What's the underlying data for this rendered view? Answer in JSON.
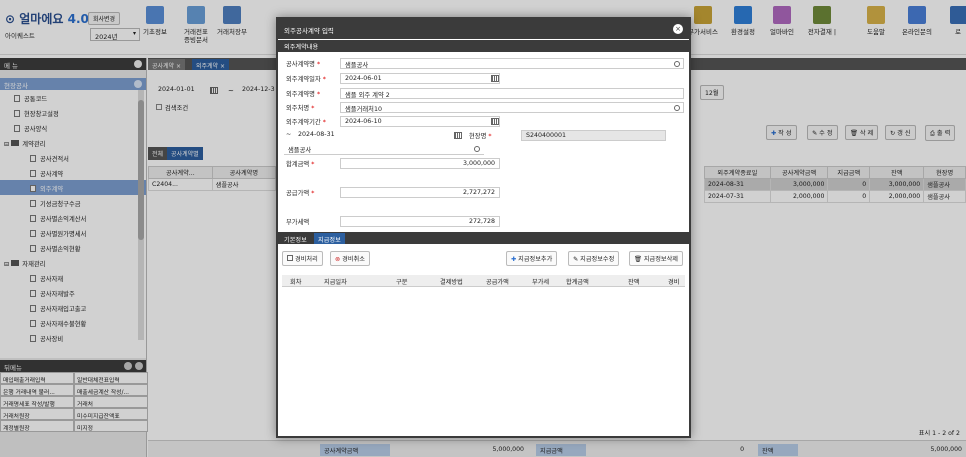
{
  "app": {
    "logo_a": "얼마에요",
    "logo_v": "4.0",
    "company_change": "회사변경",
    "company": "아이퀘스트",
    "year": "2024년"
  },
  "toolbar": [
    {
      "label": "기초정보",
      "color": "#5a8fd8"
    },
    {
      "label": "거래전표\n증빙문서",
      "color": "#6a9fd8"
    },
    {
      "label": "거래처장부",
      "color": "#4f7fc0"
    },
    {
      "label": "부가서비스",
      "color": "#c9a437"
    },
    {
      "label": "환경설정",
      "color": "#2f7fd8"
    },
    {
      "label": "얼마바인",
      "color": "#b06ac0"
    },
    {
      "label": "전자결재 |",
      "color": "#6f8a3a"
    },
    {
      "label": "도움말",
      "color": "#d8b24a"
    },
    {
      "label": "온라인문의",
      "color": "#4a7fd8"
    },
    {
      "label": "로",
      "color": "#3a6fb8"
    }
  ],
  "sidebar": {
    "menu_label": "메 뉴",
    "section": "현장공사",
    "items": [
      {
        "label": "공통코드",
        "level": 1,
        "type": "doc"
      },
      {
        "label": "현장창고설정",
        "level": 1,
        "type": "doc"
      },
      {
        "label": "공사양식",
        "level": 1,
        "type": "doc"
      },
      {
        "label": "계약관리",
        "level": 0,
        "type": "folder"
      },
      {
        "label": "공사견적서",
        "level": 2,
        "type": "doc"
      },
      {
        "label": "공사계약",
        "level": 2,
        "type": "doc"
      },
      {
        "label": "외주계약",
        "level": 2,
        "type": "doc",
        "selected": true
      },
      {
        "label": "기성금청구수금",
        "level": 2,
        "type": "doc"
      },
      {
        "label": "공사별손익계산서",
        "level": 2,
        "type": "doc"
      },
      {
        "label": "공사별원가명세서",
        "level": 2,
        "type": "doc"
      },
      {
        "label": "공사별손익현황",
        "level": 2,
        "type": "doc"
      },
      {
        "label": "자재관리",
        "level": 0,
        "type": "folder"
      },
      {
        "label": "공사자재",
        "level": 2,
        "type": "doc"
      },
      {
        "label": "공사자재발주",
        "level": 2,
        "type": "doc"
      },
      {
        "label": "공사자재입고출고",
        "level": 2,
        "type": "doc"
      },
      {
        "label": "공사자재수불현황",
        "level": 2,
        "type": "doc"
      },
      {
        "label": "공사장비",
        "level": 2,
        "type": "doc"
      }
    ],
    "fav_label": "뒤메뉴",
    "favorites": [
      "매입매출거래입력",
      "일반대체전표입력",
      "은행 거래내역 불러...",
      "매출세금계산 작성/...",
      "거래명세표 작성/발행",
      "거래처",
      "거래처원장",
      "미수미지급잔액표",
      "계정별원장",
      "미지정"
    ]
  },
  "main": {
    "tabs": [
      "공사계약",
      "외주계약"
    ],
    "date_from": "2024-01-01",
    "date_to": "2024-12-3",
    "search_cond": "검색조건",
    "month_btn": "12월",
    "grid_tabs": [
      "전체",
      "공사계약별"
    ],
    "actions": [
      "작 성",
      "수 정",
      "삭 제",
      "갱 신",
      "출 력"
    ],
    "left_headers": [
      "공사계약...",
      "공사계약명"
    ],
    "left_rows": [
      [
        "C2404...",
        "샘플공사"
      ]
    ],
    "right_headers": [
      "외주계약종료일",
      "공사계약금액",
      "지급금액",
      "잔액",
      "현장명"
    ],
    "right_rows": [
      [
        "2024-08-31",
        "3,000,000",
        "0",
        "3,000,000",
        "샘플공사"
      ],
      [
        "2024-07-31",
        "2,000,000",
        "0",
        "2,000,000",
        "샘플공사"
      ]
    ],
    "paging": "표시 1 - 2 of 2"
  },
  "footer": {
    "label1": "공사계약금액",
    "val1": "5,000,000",
    "label2": "지급금액",
    "val2": "0",
    "label3": "잔액",
    "val3": "5,000,000"
  },
  "modal": {
    "title": "외주공사계약 입력",
    "section": "외주계약내용",
    "fields": {
      "project_label": "공사계약명",
      "project": "샘플공사",
      "date_label": "외주계약일자",
      "date": "2024-06-01",
      "name_label": "외주계약명",
      "name": "샘플 외주 계약 2",
      "vendor_label": "외주처명",
      "vendor": "샘플거래처10",
      "period_label": "외주계약기간",
      "period_start": "2024-06-10",
      "period_sep": "~",
      "period_end": "2024-08-31",
      "site_label": "현장명",
      "site_code": "S240400001",
      "site_name": "샘플공사",
      "total_label": "합계금액",
      "total": "3,000,000",
      "supply_label": "공급가액",
      "supply": "2,727,272",
      "vat_label": "부가세액",
      "vat": "272,728"
    },
    "tabs": [
      "기본정보",
      "지급정보"
    ],
    "buttons": [
      "경비처리",
      "경비취소",
      "지급정보추가",
      "지급정보수정",
      "지급정보삭제"
    ],
    "grid_headers": [
      "회차",
      "지급일자",
      "구분",
      "결제방법",
      "공급가액",
      "부가세",
      "합계금액",
      "잔액",
      "경비"
    ]
  }
}
